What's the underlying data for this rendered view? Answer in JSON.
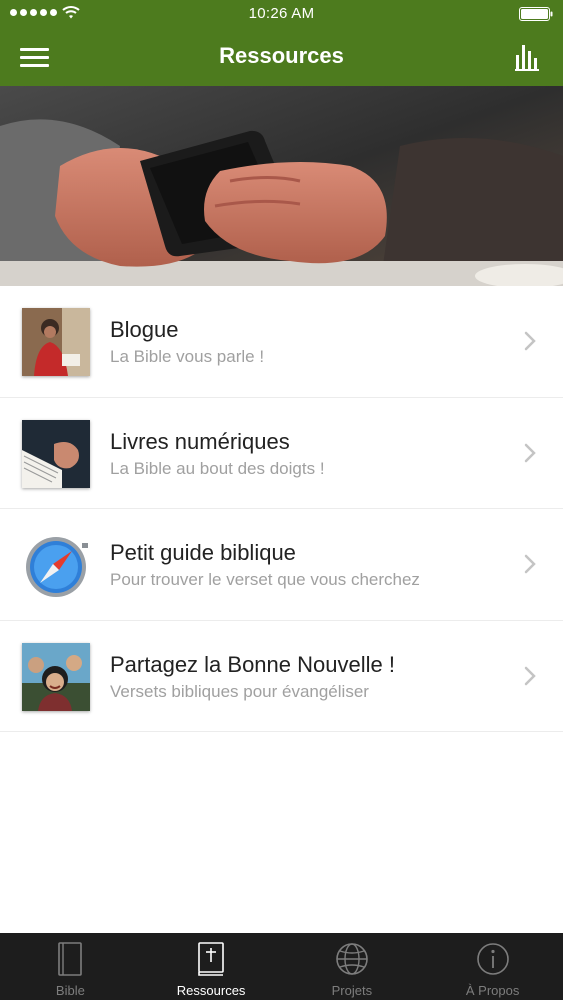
{
  "status_bar": {
    "time": "10:26 AM"
  },
  "nav": {
    "title": "Ressources",
    "menu_icon": "hamburger-menu-icon",
    "right_icon": "bar-chart-icon"
  },
  "colors": {
    "accent": "#4d7b1e",
    "tabbar_bg": "#1d1d1d",
    "subtitle": "#a0a0a0"
  },
  "resources": [
    {
      "title": "Blogue",
      "subtitle": "La Bible vous parle !",
      "thumbnail": "woman-reading-photo"
    },
    {
      "title": "Livres numériques",
      "subtitle": "La Bible au bout des doigts !",
      "thumbnail": "tablet-book-photo"
    },
    {
      "title": "Petit guide biblique",
      "subtitle": "Pour trouver le verset que vous cherchez",
      "thumbnail": "compass-icon"
    },
    {
      "title": "Partagez la Bonne Nouvelle !",
      "subtitle": "Versets bibliques pour évangéliser",
      "thumbnail": "people-smiling-photo"
    }
  ],
  "tabs": [
    {
      "label": "Bible",
      "icon": "book-icon",
      "active": false
    },
    {
      "label": "Ressources",
      "icon": "bible-cross-icon",
      "active": true
    },
    {
      "label": "Projets",
      "icon": "globe-icon",
      "active": false
    },
    {
      "label": "À Propos",
      "icon": "info-icon",
      "active": false
    }
  ]
}
